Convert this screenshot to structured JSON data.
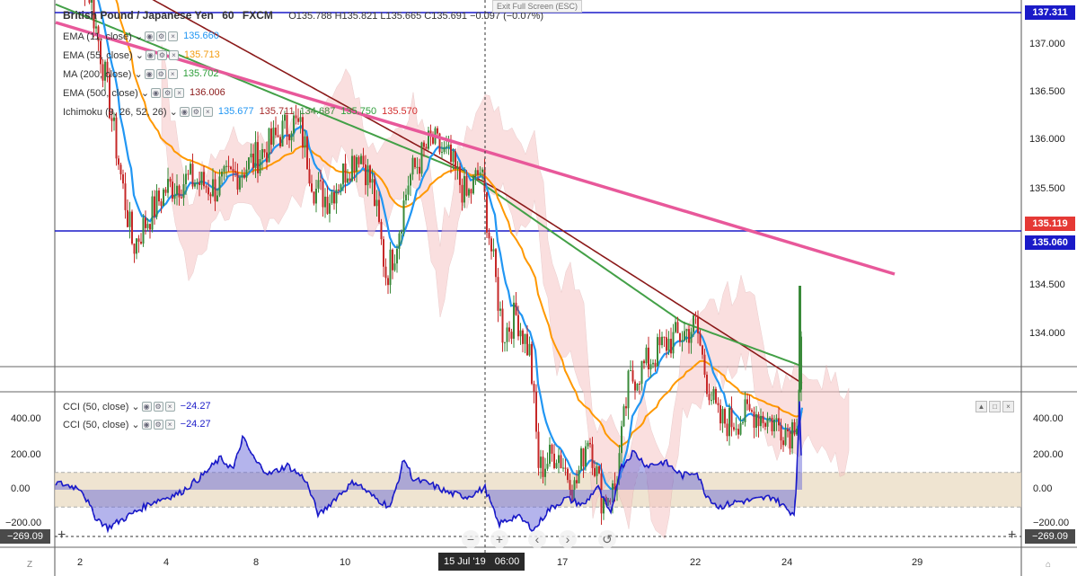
{
  "header": {
    "title": "British Pound / Japanese Yen",
    "interval": "60",
    "source": "FXCM",
    "ohlc": "O135.788  H135.821  L135.665  C135.691  −0.097 (−0.07%)"
  },
  "exit_fullscreen": "Exit Full Screen (ESC)",
  "indicators": [
    {
      "label": "EMA (11, close)",
      "value": "135.660",
      "color": "#2196f3"
    },
    {
      "label": "EMA (55, close)",
      "value": "135.713",
      "color": "#f39c12"
    },
    {
      "label": "MA (200, close)",
      "value": "135.702",
      "color": "#2e9e3a"
    },
    {
      "label": "EMA (500, close)",
      "value": "136.006",
      "color": "#8b1a1a"
    },
    {
      "label": "Ichimoku (9, 26, 52, 26)",
      "values": [
        "135.677",
        "135.711",
        "134.687",
        "135.750",
        "135.570"
      ],
      "colors": [
        "#2196f3",
        "#a52a2a",
        "#3a8a3a",
        "#2e9e3a",
        "#d32f2f"
      ]
    }
  ],
  "cci_legend": [
    {
      "label": "CCI (50, close)",
      "value": "−24.27"
    },
    {
      "label": "CCI (50, close)",
      "value": "−24.27"
    }
  ],
  "price_axis": {
    "ticks": [
      "137.000",
      "136.500",
      "136.000",
      "135.500",
      "134.500",
      "134.000"
    ],
    "labels": [
      {
        "text": "137.311",
        "color": "#1a1ac8"
      },
      {
        "text": "135.119",
        "color": "#e53935"
      },
      {
        "text": "135.060",
        "color": "#1a1ac8"
      }
    ]
  },
  "cci_axis": {
    "ticks": [
      "400.00",
      "200.00",
      "0.00",
      "−200.00"
    ],
    "left_ticks": [
      "400.00",
      "200.00",
      "0.00",
      "−200.00"
    ],
    "cross_value": "−269.09"
  },
  "time_axis": {
    "ticks": [
      "2",
      "4",
      "8",
      "10",
      "17",
      "22",
      "24",
      "29"
    ],
    "crosshair_date": "15 Jul '19",
    "crosshair_time": "06:00"
  },
  "nav_buttons": [
    "−",
    "+",
    "‹",
    "›",
    "↺"
  ],
  "corner": {
    "left": "Z",
    "right": "⌂"
  },
  "colors": {
    "ema11": "#2196f3",
    "ema55": "#ff9800",
    "ma200": "#43a047",
    "ema500": "#8b1a1a",
    "trend": "#e8589a",
    "hline": "#1a1ac8",
    "cci": "#1a1ac8",
    "up": "#3a8a3a",
    "down": "#c62828"
  }
}
